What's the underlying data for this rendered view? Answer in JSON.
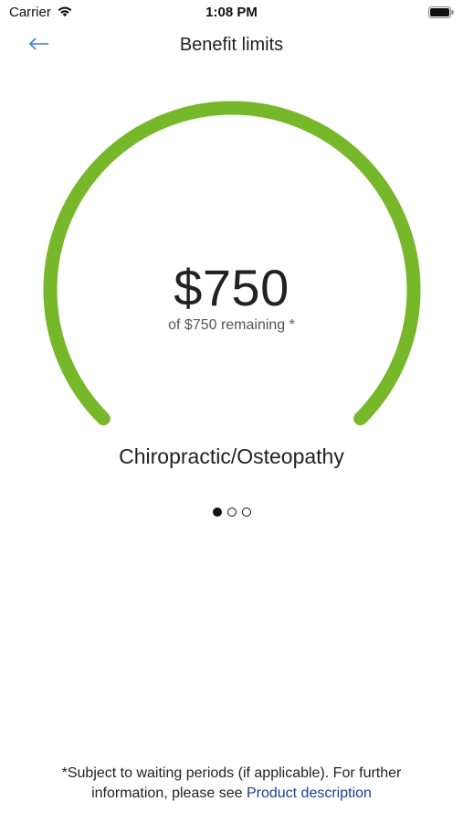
{
  "status_bar": {
    "carrier": "Carrier",
    "time": "1:08 PM"
  },
  "nav": {
    "title": "Benefit limits",
    "back_icon": "arrow-left-icon"
  },
  "benefit": {
    "amount": "$750",
    "remaining_text": "of $750 remaining *",
    "category": "Chiropractic/Osteopathy",
    "remaining_fraction": 1.0,
    "accent_color": "#77b72a"
  },
  "pager": {
    "total": 3,
    "active_index": 0
  },
  "footer": {
    "note": "*Subject to waiting periods (if applicable). For further information, please see",
    "link_text": "Product description",
    "link_color": "#1c3f94"
  }
}
